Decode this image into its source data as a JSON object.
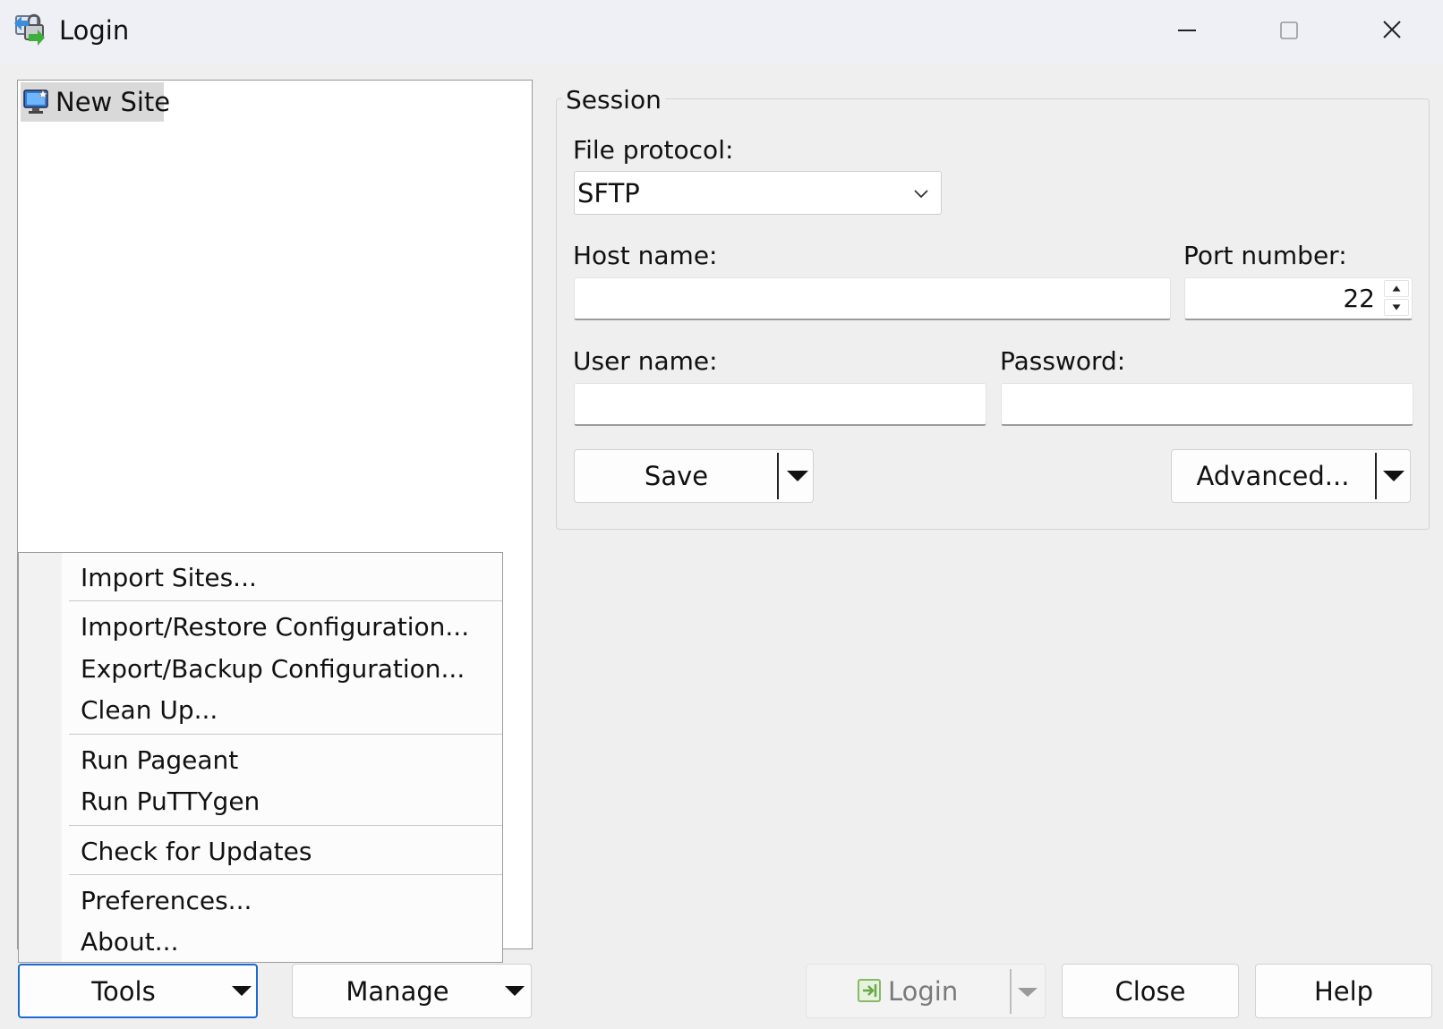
{
  "window": {
    "title": "Login",
    "icon": "winscp-login-icon",
    "controls": [
      "minimize-icon",
      "maximize-icon",
      "close-icon"
    ]
  },
  "site_tree": {
    "items": [
      {
        "label": "New Site",
        "icon": "new-site-icon",
        "selected": true
      }
    ]
  },
  "session": {
    "legend": "Session",
    "file_protocol_label": "File protocol:",
    "file_protocol_value": "SFTP",
    "host_label": "Host name:",
    "host_value": "",
    "port_label": "Port number:",
    "port_value": "22",
    "user_label": "User name:",
    "user_value": "",
    "password_label": "Password:",
    "password_value": "",
    "save_label": "Save",
    "advanced_label": "Advanced..."
  },
  "tools_menu": {
    "items": [
      "Import Sites...",
      "Import/Restore Configuration...",
      "Export/Backup Configuration...",
      "Clean Up...",
      "Run Pageant",
      "Run PuTTYgen",
      "Check for Updates",
      "Preferences...",
      "About..."
    ]
  },
  "bottom": {
    "tools_label": "Tools",
    "manage_label": "Manage",
    "login_label": "Login",
    "close_label": "Close",
    "help_label": "Help"
  },
  "colors": {
    "accent": "#1b6ad0",
    "titlebar": "#eef0f6",
    "background": "#efefef",
    "selection": "#d9d9d9"
  }
}
